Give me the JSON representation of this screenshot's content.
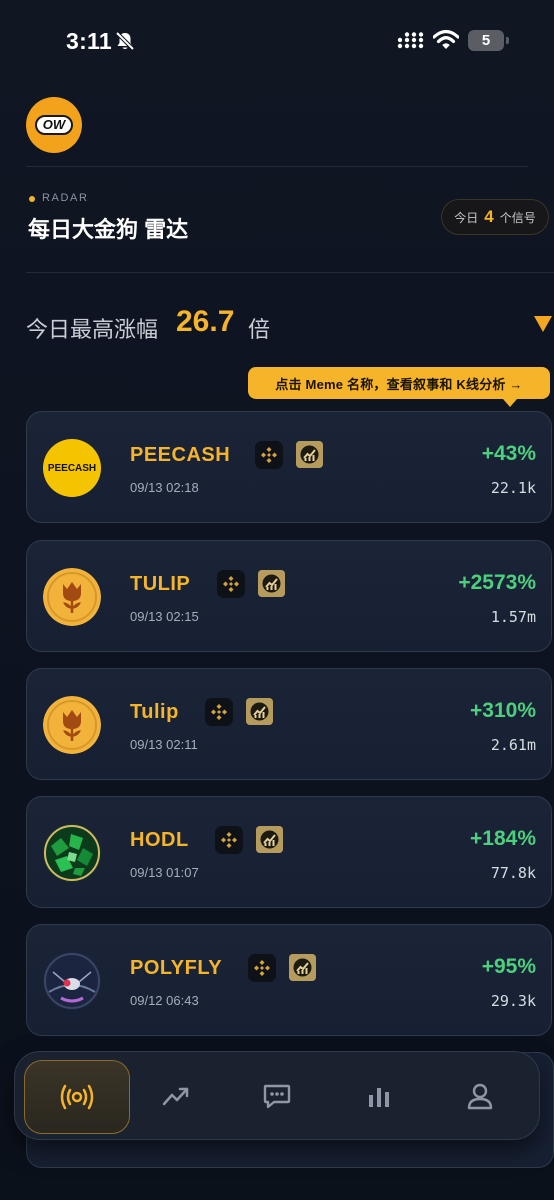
{
  "status_bar": {
    "time": "3:11",
    "battery": "5"
  },
  "header": {
    "logo_text": "OW",
    "section_label": "RADAR",
    "title": "每日大金狗 雷达",
    "signal_badge": {
      "prefix": "今日",
      "count": "4",
      "suffix": "个信号"
    }
  },
  "summary": {
    "label": "今日最高涨幅",
    "value": "26.7",
    "unit": "倍"
  },
  "tooltip": {
    "text": "点击 Meme 名称，查看叙事和 K线分析 →"
  },
  "coins": [
    {
      "name": "PEECASH",
      "time": "09/13 02:18",
      "change": "+43%",
      "volume": "22.1k",
      "logo_text": "PEECASH"
    },
    {
      "name": "TULIP",
      "time": "09/13 02:15",
      "change": "+2573%",
      "volume": "1.57m"
    },
    {
      "name": "Tulip",
      "time": "09/13 02:11",
      "change": "+310%",
      "volume": "2.61m"
    },
    {
      "name": "HODL",
      "time": "09/13 01:07",
      "change": "+184%",
      "volume": "77.8k"
    },
    {
      "name": "POLYFLY",
      "time": "09/12 06:43",
      "change": "+95%",
      "volume": "29.3k"
    }
  ],
  "nav": {
    "items": [
      "radar-icon",
      "trend-icon",
      "chat-icon",
      "bar-chart-icon",
      "user-icon"
    ],
    "active": "radar-icon"
  },
  "colors": {
    "accent": "#f5b42a",
    "positive": "#4cd07d",
    "background": "#0d1320",
    "card": "#1b2436"
  }
}
